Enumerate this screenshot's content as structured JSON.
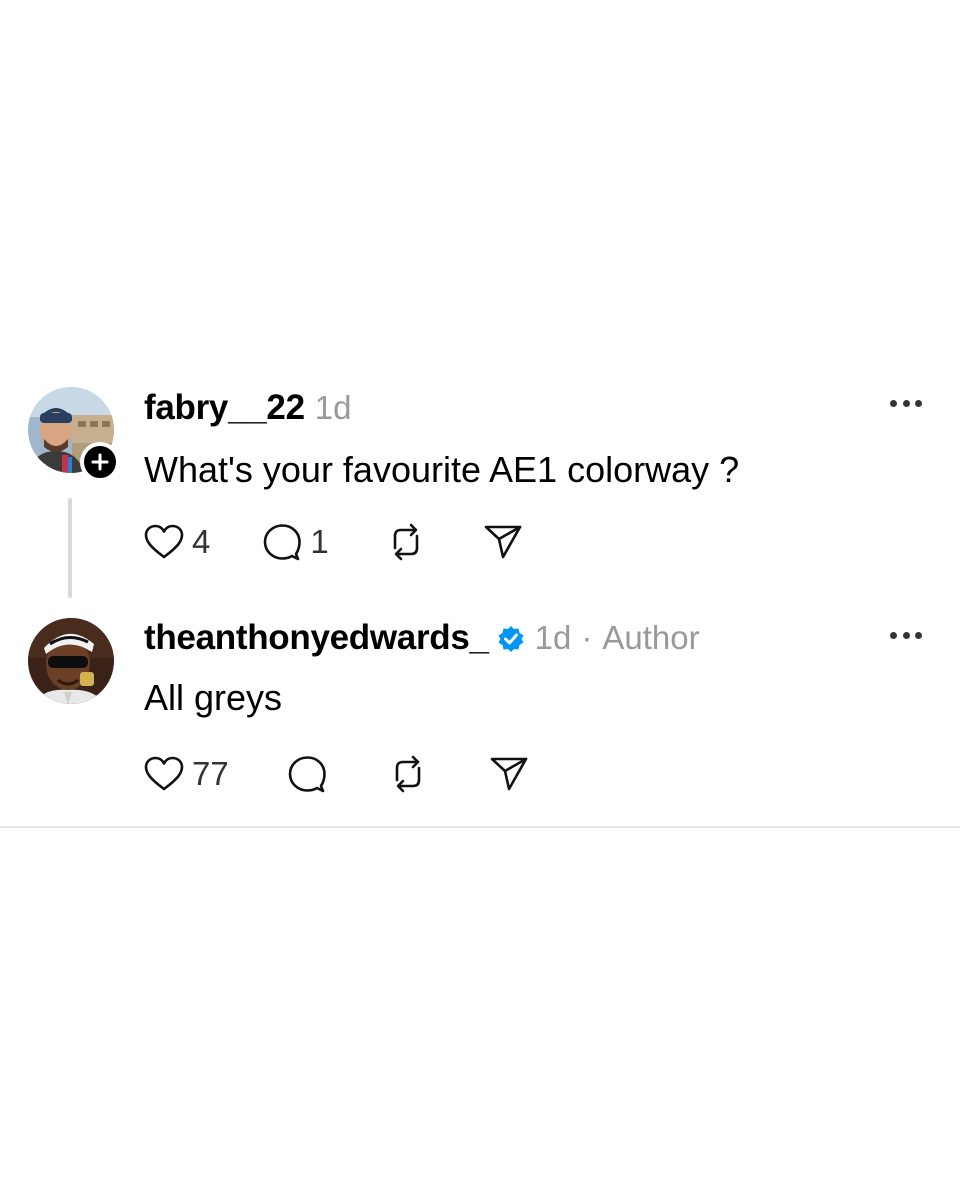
{
  "posts": [
    {
      "username": "fabry__22",
      "time": "1d",
      "text": "What's your favourite AE1 colorway ?",
      "likes": "4",
      "replies": "1",
      "verified": false,
      "follow_badge": true
    },
    {
      "username": "theanthonyedwards_",
      "time": "1d",
      "meta_separator": "·",
      "role": "Author",
      "text": "All greys",
      "likes": "77",
      "verified": true,
      "follow_badge": false
    }
  ],
  "icons": {
    "like": "heart-icon",
    "reply": "comment-icon",
    "repost": "repost-icon",
    "share": "send-icon",
    "more": "more-icon",
    "verified": "verified-badge-icon",
    "follow": "plus-icon"
  },
  "colors": {
    "text": "#000000",
    "meta": "#999999",
    "verified": "#0095f6",
    "thread_line": "#d9d9d9"
  }
}
